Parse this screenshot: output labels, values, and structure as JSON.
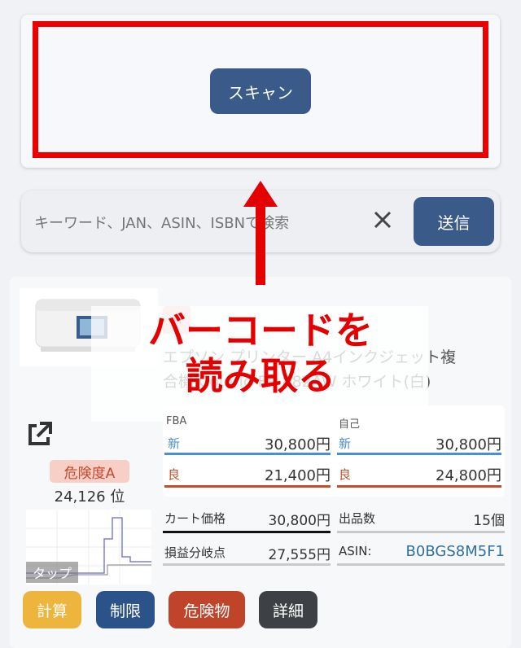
{
  "scan": {
    "button_label": "スキャン"
  },
  "search": {
    "placeholder": "キーワード、JAN、ASIN、ISBNで検索",
    "send_label": "送信"
  },
  "annotation": {
    "line1": "バーコードを",
    "line2": "読み取る"
  },
  "product": {
    "badge": "A",
    "title_line1": "エプソン プリンター A4インクジェット複",
    "title_line2": "合機 Colorio EP-882AW ホワイト(白)",
    "risk_label": "危険度A",
    "rank": "24,126 位",
    "tap_label": "タップ"
  },
  "prices": {
    "fba_label": "FBA",
    "self_label": "自己",
    "new_tag": "新",
    "used_tag": "良",
    "fba_new": "30,800円",
    "fba_used": "21,400円",
    "self_new": "30,800円",
    "self_used": "24,800円"
  },
  "stats": {
    "cart_label": "カート価格",
    "cart_value": "30,800円",
    "sellers_label": "出品数",
    "sellers_value": "15個",
    "breakeven_label": "損益分岐点",
    "breakeven_value": "27,555円",
    "asin_label": "ASIN:",
    "asin_value": "B0BGS8M5F1"
  },
  "actions": {
    "calc": "計算",
    "restrict": "制限",
    "hazard": "危険物",
    "detail": "詳細"
  },
  "colors": {
    "primary": "#3a5a8a",
    "red": "#e50000",
    "new_blue": "#4a8fd0",
    "used_red": "#c0502c"
  }
}
